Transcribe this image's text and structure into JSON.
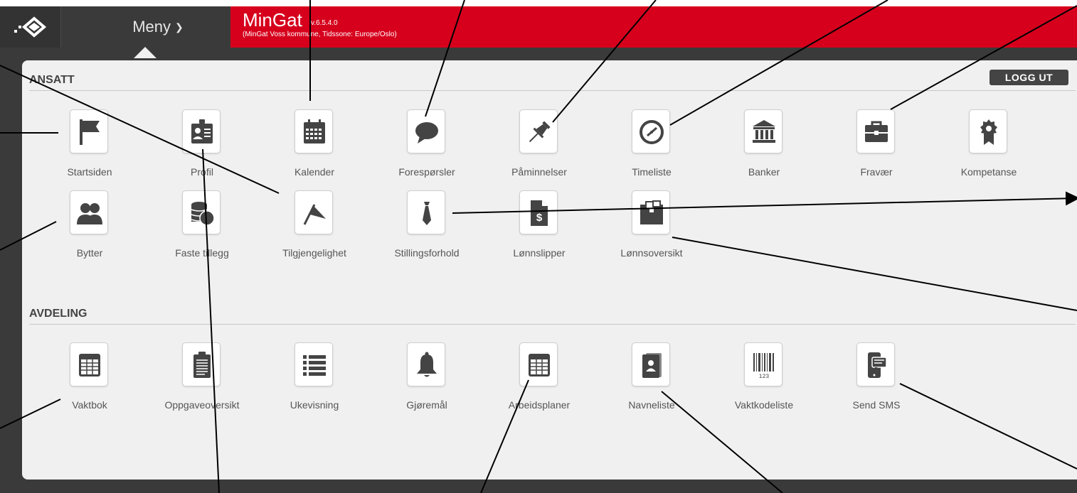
{
  "header": {
    "menu_label": "Meny",
    "app_name": "MinGat",
    "app_version": "v.6.5.4.0",
    "app_subtitle": "(MinGat Voss kommune, Tidssone: Europe/Oslo)"
  },
  "colors": {
    "brand_red": "#d6001c",
    "dark_bar": "#3a3a3a",
    "panel": "#f0f0f0",
    "icon": "#444444"
  },
  "logout_label": "LOGG UT",
  "ansatt": {
    "title": "ANSATT",
    "items": [
      {
        "label": "Startsiden",
        "icon": "flag-icon"
      },
      {
        "label": "Profil",
        "icon": "id-badge-icon"
      },
      {
        "label": "Kalender",
        "icon": "calendar-icon"
      },
      {
        "label": "Forespørsler",
        "icon": "speech-bubble-icon"
      },
      {
        "label": "Påminnelser",
        "icon": "pushpin-icon"
      },
      {
        "label": "Timeliste",
        "icon": "clock-icon"
      },
      {
        "label": "Banker",
        "icon": "bank-icon"
      },
      {
        "label": "Fravær",
        "icon": "briefcase-icon"
      },
      {
        "label": "Kompetanse",
        "icon": "certificate-icon"
      },
      {
        "label": "Bytter",
        "icon": "users-icon"
      },
      {
        "label": "Faste tillegg",
        "icon": "coins-icon"
      },
      {
        "label": "Tilgjengelighet",
        "icon": "flag-pennant-icon"
      },
      {
        "label": "Stillingsforhold",
        "icon": "tie-icon"
      },
      {
        "label": "Lønnslipper",
        "icon": "dollar-document-icon"
      },
      {
        "label": "Lønnsoversikt",
        "icon": "archive-box-icon"
      }
    ]
  },
  "avdeling": {
    "title": "AVDELING",
    "items": [
      {
        "label": "Vaktbok",
        "icon": "table-icon"
      },
      {
        "label": "Oppgaveoversikt",
        "icon": "clipboard-icon"
      },
      {
        "label": "Ukevisning",
        "icon": "list-icon"
      },
      {
        "label": "Gjøremål",
        "icon": "bell-icon"
      },
      {
        "label": "Arbeidsplaner",
        "icon": "table-icon"
      },
      {
        "label": "Navneliste",
        "icon": "contact-book-icon"
      },
      {
        "label": "Vaktkodeliste",
        "icon": "barcode-icon"
      },
      {
        "label": "Send SMS",
        "icon": "mobile-message-icon"
      }
    ]
  }
}
